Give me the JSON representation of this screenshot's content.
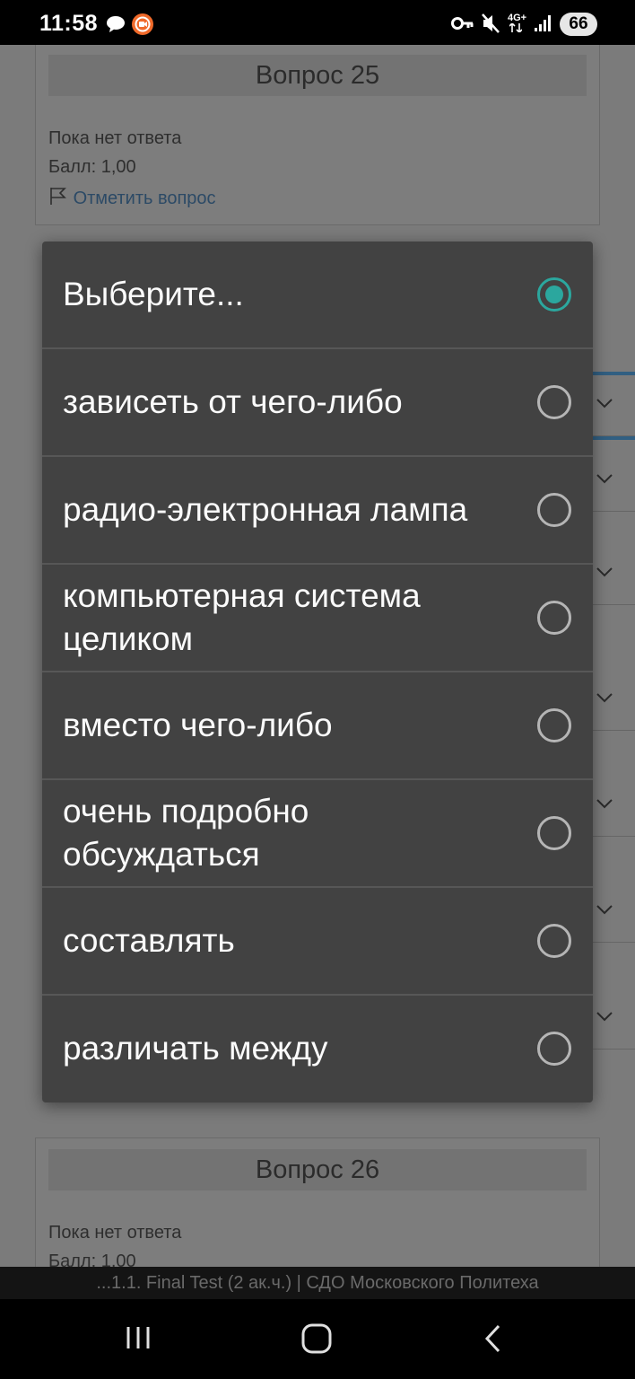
{
  "status_bar": {
    "time": "11:58",
    "icons": [
      "chat-icon",
      "screen-record-icon",
      "vpn-key-icon",
      "mute-icon",
      "network-4g-icon",
      "signal-icon"
    ],
    "network": "4G+",
    "battery": "66"
  },
  "background": {
    "question_25": {
      "title": "Вопрос 25",
      "status": "Пока нет ответа",
      "score": "Балл: 1,00",
      "flag_label": "Отметить вопрос"
    },
    "question_26": {
      "title": "Вопрос 26",
      "status": "Пока нет ответа",
      "score": "Балл: 1,00"
    }
  },
  "dialog": {
    "selected_index": 0,
    "options": [
      {
        "label": "Выберите...",
        "checked": true
      },
      {
        "label": "зависеть от чего-либо",
        "checked": false
      },
      {
        "label": "радио-электронная лампа",
        "checked": false
      },
      {
        "label": "компьютерная система целиком",
        "checked": false
      },
      {
        "label": "вместо чего-либо",
        "checked": false
      },
      {
        "label": "очень подробно обсуждаться",
        "checked": false
      },
      {
        "label": "составлять",
        "checked": false
      },
      {
        "label": "различать между",
        "checked": false
      }
    ],
    "accent_color": "#2ba79e"
  },
  "browser_title": "...1.1. Final Test (2 ак.ч.) | СДО Московского Политеха",
  "nav_bar": {
    "buttons": [
      "recent-apps-icon",
      "home-icon",
      "back-icon"
    ]
  }
}
